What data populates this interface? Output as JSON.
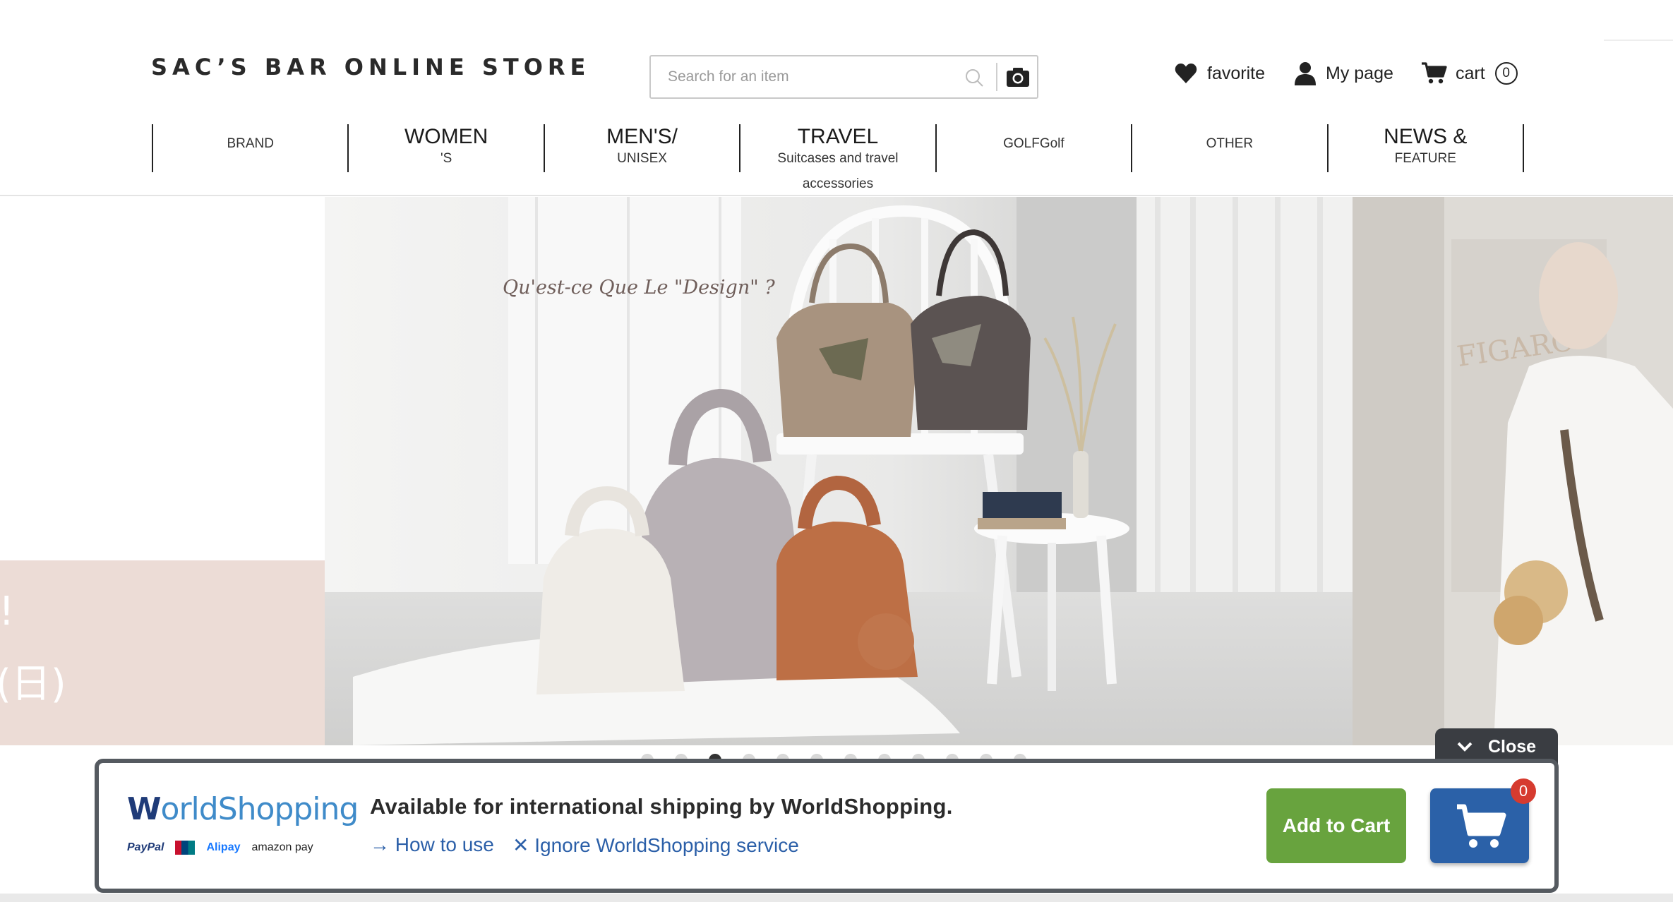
{
  "header": {
    "logo_text": "SAC’S BAR ONLINE STORE",
    "search_placeholder": "Search for an item",
    "favorite_label": "favorite",
    "mypage_label": "My page",
    "cart_label": "cart",
    "cart_count": "0"
  },
  "nav": {
    "brand": "BRAND",
    "women_main": "WOMEN",
    "women_sub": "'S",
    "mens_main": "MEN'S/",
    "mens_sub": "UNISEX",
    "travel_main": "TRAVEL",
    "travel_sub": "Suitcases and travel",
    "travel_sub2": "accessories",
    "golf": "GOLFGolf",
    "other": "OTHER",
    "news_main": "NEWS &",
    "news_sub": "FEATURE"
  },
  "hero": {
    "main_caption": "Qu'est-ce Que Le \"Design\" ?",
    "left_text_1": "!",
    "left_text_2": "(日)",
    "right_text": "FIGARO",
    "slide_count": 12,
    "active_slide": 3
  },
  "worldshopping": {
    "close_label": "Close",
    "logo_prefix": "W",
    "logo_text": "orldShopping",
    "pay_paypal": "PayPal",
    "pay_alipay": "Alipay",
    "pay_amazon": "amazon pay",
    "message": "Available for international shipping by WorldShopping.",
    "how_to_use": "How to use",
    "ignore": "Ignore WorldShopping service",
    "add_to_cart": "Add to Cart",
    "cart_badge": "0"
  },
  "colors": {
    "accent_green": "#68a33e",
    "accent_blue": "#2b61a8",
    "badge_red": "#d63b2f",
    "pink_panel": "#ecdcd6"
  }
}
